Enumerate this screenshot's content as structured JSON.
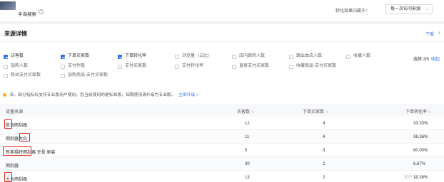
{
  "topbar": {
    "title": "手淘搜索",
    "help_icon": "?",
    "conversion_label": "转化效果归属于：",
    "conversion_select": "每一次访问来源",
    "chevron_icon": "chevron-down-icon"
  },
  "panel": {
    "title": "来源详情",
    "download_label": "下载",
    "download_icon": "download-icon"
  },
  "metrics": [
    {
      "label": "访客数",
      "checked": true
    },
    {
      "label": "下单买家数",
      "checked": true
    },
    {
      "label": "下单转化率",
      "checked": true
    },
    {
      "label": "浏览量（占比）",
      "checked": false
    },
    {
      "label": "店内跳转人数",
      "checked": false
    },
    {
      "label": "跳出本店人数",
      "checked": false
    },
    {
      "label": "收藏人数",
      "checked": false
    },
    {
      "label": "加购人数",
      "checked": false
    },
    {
      "label": "支付件数",
      "checked": false
    },
    {
      "label": "支付买家数",
      "checked": false
    },
    {
      "label": "支付转化率",
      "checked": false
    },
    {
      "label": "直接支付买家数",
      "checked": false
    },
    {
      "label": "收藏商品-支付买家数",
      "checked": false
    },
    {
      "label": "粉丝支付买家数",
      "checked": false
    },
    {
      "label": "加购商品-支付买家数",
      "checked": false
    }
  ],
  "select_count": "选择 3/5",
  "collapse_label": "收起",
  "notice": {
    "text": "亲，部分指标仅支持专业版用户使用，您当前使用的是标准版，如需使用请升级为专业版。",
    "link": "立即升级 >"
  },
  "table": {
    "headers": [
      "流量来源",
      "访客数",
      "下单买家数",
      "下单转化率"
    ],
    "rows": [
      {
        "source": "航海雨刮器",
        "visitors": "12",
        "buyers": "4",
        "rate": "33.33%"
      },
      {
        "source": "雨刮器大众",
        "visitors": "11",
        "buyers": "4",
        "rate": "36.36%"
      },
      {
        "source": "新奥福特雨刮器 无骨 原装",
        "visitors": "5",
        "buyers": "3",
        "rate": "60.00%"
      },
      {
        "source": "雨刮器",
        "visitors": "30",
        "buyers": "2",
        "rate": "6.67%"
      },
      {
        "source": "大众雨刮器",
        "visitors": "13",
        "buyers": "2",
        "rate": "15.38%"
      }
    ]
  },
  "watermark": "知乎 @"
}
